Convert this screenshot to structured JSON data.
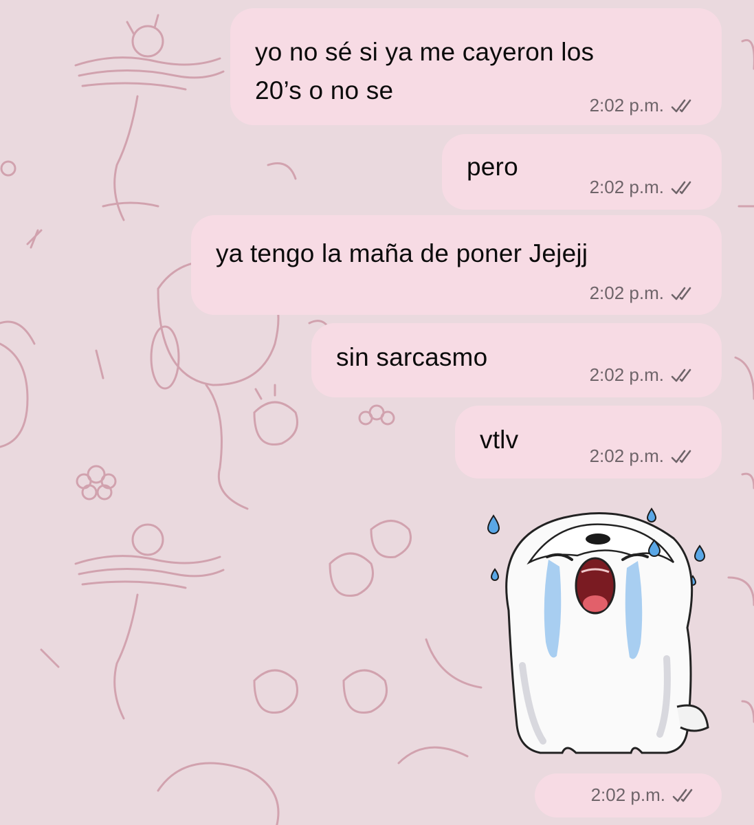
{
  "chat": {
    "messages": [
      {
        "text": "yo no sé si ya me cayeron los\n20’s o no se",
        "time": "2:02 p.m.",
        "status": "double-check-icon"
      },
      {
        "text": "pero",
        "time": "2:02 p.m.",
        "status": "double-check-icon"
      },
      {
        "text": "ya tengo la maña de poner Jejejj",
        "time": "2:02 p.m.",
        "status": "double-check-icon"
      },
      {
        "text": "sin sarcasmo",
        "time": "2:02 p.m.",
        "status": "double-check-icon"
      },
      {
        "text": "vtlv",
        "time": "2:02 p.m.",
        "status": "double-check-icon"
      }
    ],
    "sticker": {
      "icon": "crying-white-dog-sticker",
      "time": "2:02 p.m.",
      "status": "double-check-icon"
    }
  },
  "colors": {
    "background": "#ead9de",
    "bubble": "#f7dbe4",
    "pattern": "#c9909f",
    "meta_text": "#6e6469"
  }
}
